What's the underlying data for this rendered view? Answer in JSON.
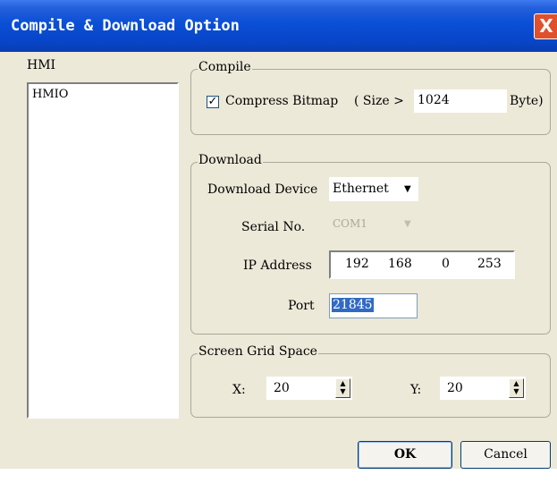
{
  "window": {
    "title": "Compile & Download Option",
    "close_glyph": "X"
  },
  "hmi": {
    "label": "HMI",
    "items": [
      "HMIO"
    ]
  },
  "compile": {
    "group_title": "Compile",
    "checkbox_checked": true,
    "check_glyph": "✓",
    "compress_label": "Compress Bitmap",
    "size_label": "( Size >",
    "size_value": "1024",
    "unit_label": "Byte)"
  },
  "download": {
    "group_title": "Download",
    "device_label": "Download Device",
    "device_value": "Ethernet",
    "serial_label": "Serial No.",
    "serial_value": "COM1",
    "ip_label": "IP Address",
    "ip": [
      "192",
      "168",
      "0",
      "253"
    ],
    "port_label": "Port",
    "port_value": "21845"
  },
  "grid": {
    "group_title": "Screen Grid Space",
    "x_label": "X:",
    "x_value": "20",
    "y_label": "Y:",
    "y_value": "20"
  },
  "buttons": {
    "ok": "OK",
    "cancel": "Cancel"
  },
  "icons": {
    "dropdown": "chevron-down-icon",
    "spin": "spin-updown-icon"
  },
  "colors": {
    "title_bar": "#0a4fd6",
    "dialog_bg": "#ece9d8",
    "selection": "#316ac5",
    "close": "#e0502d"
  }
}
